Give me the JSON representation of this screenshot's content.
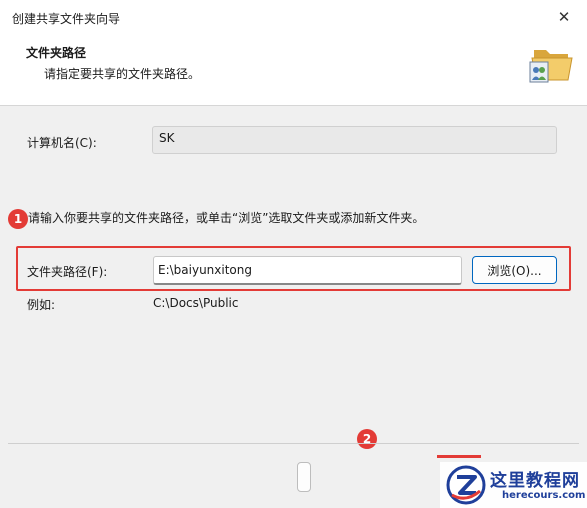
{
  "window": {
    "title": "创建共享文件夹向导",
    "close_glyph": "✕"
  },
  "header": {
    "title": "文件夹路径",
    "subtitle": "请指定要共享的文件夹路径。"
  },
  "computer": {
    "label": "计算机名(C):",
    "value": "SK"
  },
  "instruction": "请输入你要共享的文件夹路径，或单击“浏览”选取文件夹或添加新文件夹。",
  "path": {
    "label": "文件夹路径(F):",
    "value": "E:\\baiyunxitong",
    "browse_label": "浏览(O)..."
  },
  "example": {
    "label": "例如:",
    "value": "C:\\Docs\\Public"
  },
  "badges": {
    "first": "1",
    "second": "2"
  },
  "watermark": {
    "title": "这里教程网",
    "url": "herecours.com"
  },
  "colors": {
    "accent": "#0067c0",
    "highlight": "#e33b36",
    "watermark": "#1f3f9a"
  }
}
